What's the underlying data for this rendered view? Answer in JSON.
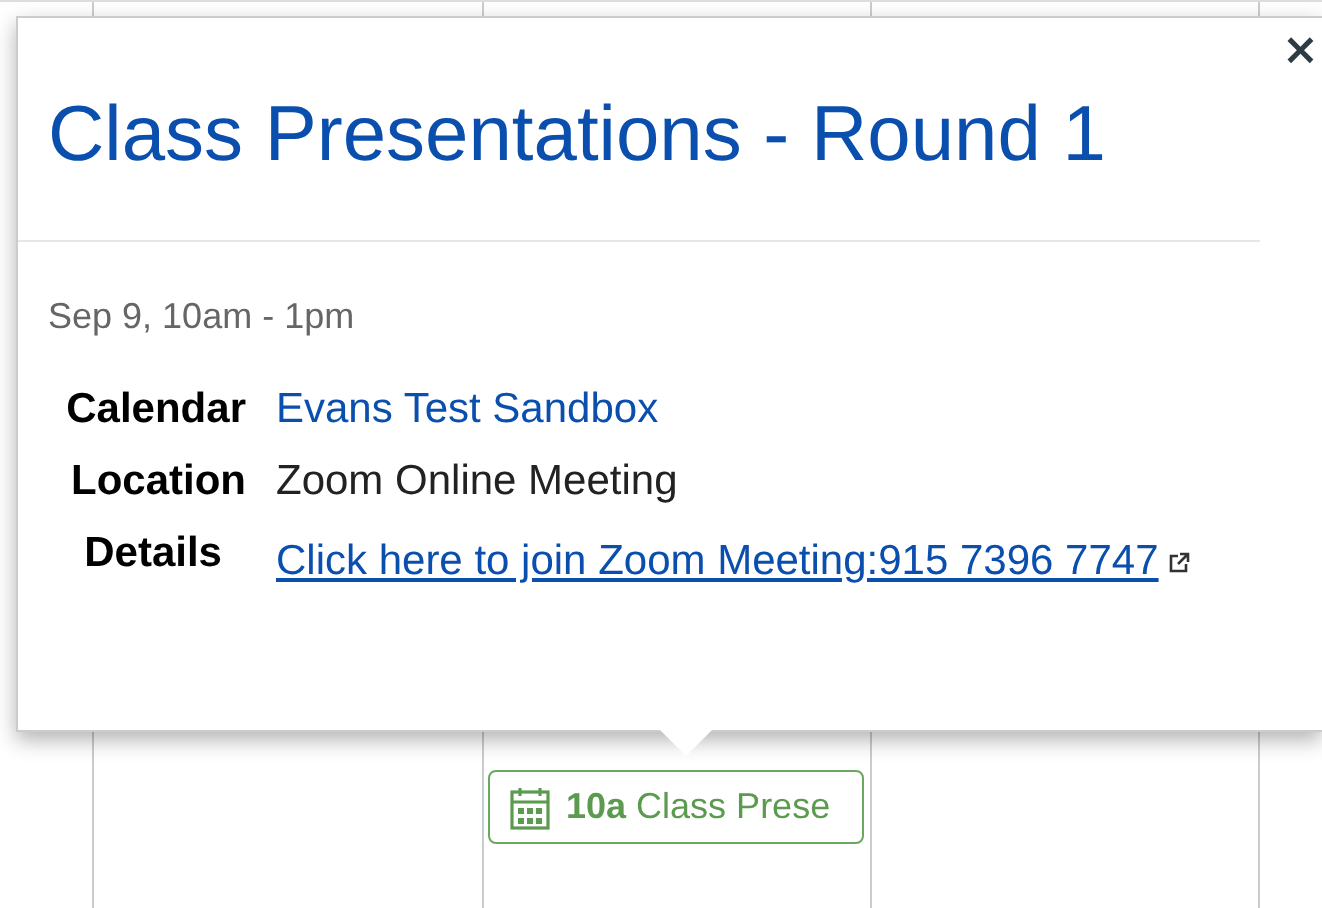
{
  "popover": {
    "title": "Class Presentations - Round 1",
    "close": "×",
    "time": "Sep 9, 10am - 1pm",
    "fields": [
      {
        "kind": "link",
        "label": "Calendar",
        "value": "Evans Test Sandbox"
      },
      {
        "kind": "text",
        "label": "Location",
        "value": "Zoom Online Meeting"
      },
      {
        "kind": "details",
        "label": "Details",
        "value": "Click here to join Zoom Meeting:915 7396 7747"
      }
    ]
  },
  "calendar": {
    "event": {
      "time": "10a",
      "title": "Class Prese"
    }
  }
}
